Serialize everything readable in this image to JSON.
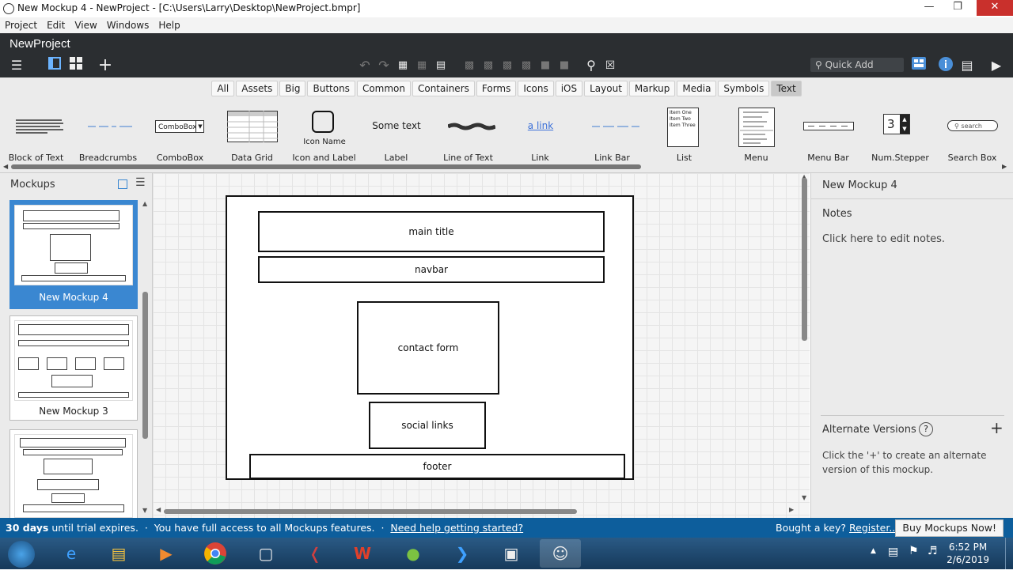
{
  "window": {
    "title": "New Mockup 4 - NewProject - [C:\\Users\\Larry\\Desktop\\NewProject.bmpr]"
  },
  "menubar": {
    "items": [
      "Project",
      "Edit",
      "View",
      "Windows",
      "Help"
    ]
  },
  "project": {
    "name": "NewProject"
  },
  "toolbar": {
    "quick_add_placeholder": "Quick Add"
  },
  "categories": [
    "All",
    "Assets",
    "Big",
    "Buttons",
    "Common",
    "Containers",
    "Forms",
    "Icons",
    "iOS",
    "Layout",
    "Markup",
    "Media",
    "Symbols",
    "Text"
  ],
  "active_category": "Text",
  "library": {
    "items": [
      "Block of Text",
      "Breadcrumbs",
      "ComboBox",
      "Data Grid",
      "Icon and Label",
      "Label",
      "Line of Text",
      "Link",
      "Link Bar",
      "List",
      "Menu",
      "Menu Bar",
      "Num.Stepper",
      "Search Box"
    ],
    "combobox_text": "ComboBox",
    "icon_name_text": "Icon Name",
    "label_text": "Some text",
    "link_text": "a link",
    "list_items": [
      "Item One",
      "Item Two",
      "Item Three"
    ],
    "stepper_value": "3",
    "search_text": "search"
  },
  "left_panel": {
    "title": "Mockups",
    "mockups": [
      "New Mockup 4",
      "New Mockup 3"
    ]
  },
  "canvas": {
    "main_title": "main title",
    "navbar": "navbar",
    "contact_form": "contact form",
    "social_links": "social links",
    "footer": "footer"
  },
  "right_panel": {
    "mockup_name": "New Mockup 4",
    "notes_heading": "Notes",
    "notes_placeholder": "Click here to edit notes.",
    "alt_heading": "Alternate Versions",
    "alt_help": "?",
    "alt_text": "Click the '+' to create an alternate version of this mockup."
  },
  "status": {
    "days": "30 days",
    "trial_text": " until trial expires.  ·  You have full access to all Mockups features.  ·  ",
    "help_link": "Need help getting started?",
    "bought_text": "Bought a key? ",
    "register_link": "Register...",
    "buy_button": "Buy Mockups Now!"
  },
  "taskbar": {
    "time": "6:52 PM",
    "date": "2/6/2019"
  }
}
